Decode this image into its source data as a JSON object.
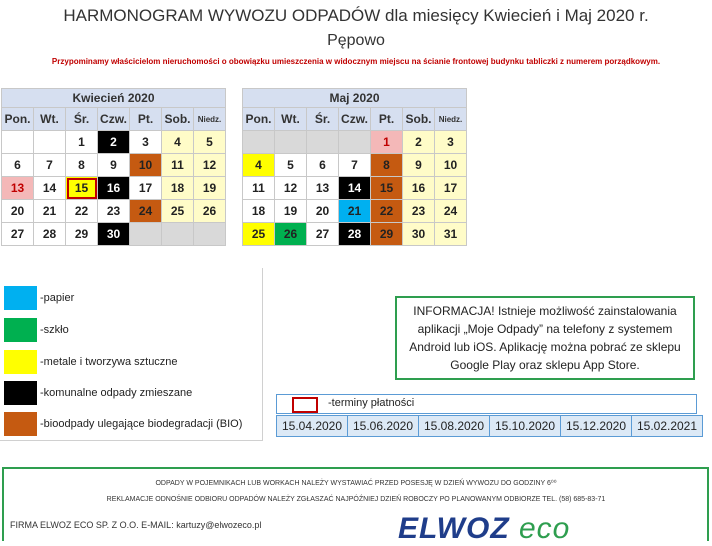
{
  "header": {
    "title": "HARMONOGRAM WYWOZU ODPADÓW  dla miesięcy Kwiecień i Maj 2020 r.",
    "subtitle": "Pępowo",
    "notice": "Przypominamy właścicielom nieruchomości o obowiązku umieszczenia w widocznym miejscu na ścianie frontowej budynku tabliczki z numerem porządkowym."
  },
  "day_headers": [
    "Pon.",
    "Wt.",
    "Śr.",
    "Czw.",
    "Pt.",
    "Sob.",
    "Niedz."
  ],
  "calendars": [
    {
      "month": "Kwiecień 2020",
      "weeks": [
        [
          [
            "",
            ""
          ],
          [
            "",
            ""
          ],
          [
            "1",
            ""
          ],
          [
            "2",
            "black"
          ],
          [
            "3",
            ""
          ],
          [
            "4",
            "wk"
          ],
          [
            "5",
            "wk"
          ]
        ],
        [
          [
            "6",
            ""
          ],
          [
            "7",
            ""
          ],
          [
            "8",
            ""
          ],
          [
            "9",
            ""
          ],
          [
            "10",
            "orange"
          ],
          [
            "11",
            "wk"
          ],
          [
            "12",
            "wk"
          ]
        ],
        [
          [
            "13",
            "pinkred"
          ],
          [
            "14",
            ""
          ],
          [
            "15",
            "yellow pay"
          ],
          [
            "16",
            "black"
          ],
          [
            "17",
            ""
          ],
          [
            "18",
            "wk"
          ],
          [
            "19",
            "wk"
          ]
        ],
        [
          [
            "20",
            ""
          ],
          [
            "21",
            ""
          ],
          [
            "22",
            ""
          ],
          [
            "23",
            ""
          ],
          [
            "24",
            "orange"
          ],
          [
            "25",
            "wk"
          ],
          [
            "26",
            "wk"
          ]
        ],
        [
          [
            "27",
            ""
          ],
          [
            "28",
            ""
          ],
          [
            "29",
            ""
          ],
          [
            "30",
            "black"
          ],
          [
            "",
            "empty"
          ],
          [
            "",
            "empty"
          ],
          [
            "",
            "empty"
          ]
        ]
      ]
    },
    {
      "month": "Maj 2020",
      "weeks": [
        [
          [
            "",
            "empty"
          ],
          [
            "",
            "empty"
          ],
          [
            "",
            "empty"
          ],
          [
            "",
            "empty"
          ],
          [
            "1",
            "pinkred"
          ],
          [
            "2",
            "wk"
          ],
          [
            "3",
            "wk"
          ]
        ],
        [
          [
            "4",
            "yellow"
          ],
          [
            "5",
            ""
          ],
          [
            "6",
            ""
          ],
          [
            "7",
            ""
          ],
          [
            "8",
            "orange"
          ],
          [
            "9",
            "wk"
          ],
          [
            "10",
            "wk"
          ]
        ],
        [
          [
            "11",
            ""
          ],
          [
            "12",
            ""
          ],
          [
            "13",
            ""
          ],
          [
            "14",
            "black"
          ],
          [
            "15",
            "orange"
          ],
          [
            "16",
            "wk"
          ],
          [
            "17",
            "wk"
          ]
        ],
        [
          [
            "18",
            ""
          ],
          [
            "19",
            ""
          ],
          [
            "20",
            ""
          ],
          [
            "21",
            "blue"
          ],
          [
            "22",
            "orange"
          ],
          [
            "23",
            "wk"
          ],
          [
            "24",
            "wk"
          ]
        ],
        [
          [
            "25",
            "yellow"
          ],
          [
            "26",
            "green"
          ],
          [
            "27",
            ""
          ],
          [
            "28",
            "black"
          ],
          [
            "29",
            "orange"
          ],
          [
            "30",
            "wk"
          ],
          [
            "31",
            "wk"
          ]
        ]
      ]
    }
  ],
  "legend": [
    {
      "color": "#00b0f0",
      "label": "-papier"
    },
    {
      "color": "#00b050",
      "label": "-szkło"
    },
    {
      "color": "#ffff00",
      "label": "-metale i tworzywa sztuczne"
    },
    {
      "color": "#000000",
      "label": "-komunalne odpady zmieszane"
    },
    {
      "color": "#c55a11",
      "label": "-bioodpady ulegające biodegradacji (BIO)"
    }
  ],
  "info": "INFORMACJA! Istnieje możliwość zainstalowania aplikacji „Moje Odpady” na telefony z systemem Android lub iOS. Aplikację można pobrać ze sklepu Google Play oraz sklepu App Store.",
  "payments": {
    "label": "-terminy płatności",
    "dates": [
      "15.04.2020",
      "15.06.2020",
      "15.08.2020",
      "15.10.2020",
      "15.12.2020",
      "15.02.2021"
    ]
  },
  "footer": {
    "line1": "ODPADY W POJEMNIKACH LUB WORKACH NALEŻY WYSTAWIAĆ PRZED POSESJĘ W DZIEŃ WYWOZU DO GODZINY 6⁰⁰",
    "line2": "REKLAMACJE ODNOŚNIE ODBIORU ODPADÓW NALEŻY ZGŁASZAĆ NAJPÓŹNIEJ DZIEŃ ROBOCZY PO PLANOWANYM ODBIORZE TEL. (58) 685-83-71",
    "firm": "FIRMA ELWOZ ECO SP. Z O.O. E-MAIL: kartuzy@elwozeco.pl",
    "logo_main": "ELWOZ",
    "logo_eco": "eco"
  }
}
